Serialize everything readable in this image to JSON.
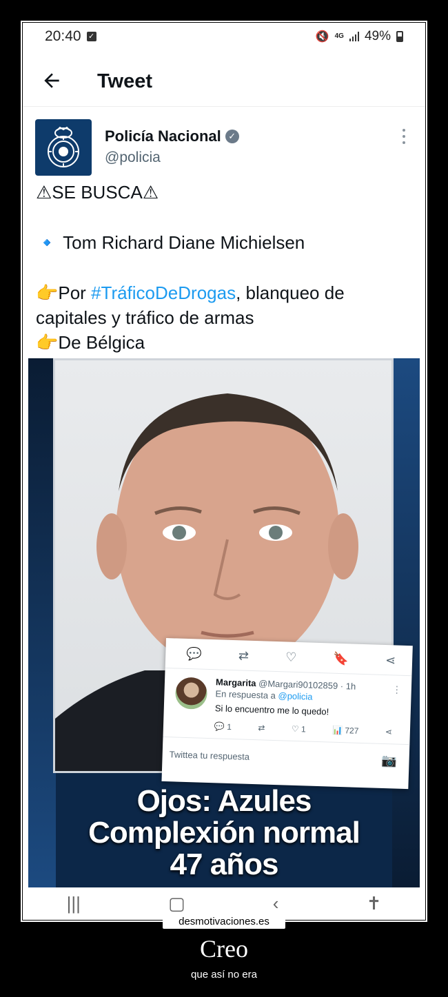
{
  "status_bar": {
    "time": "20:40",
    "battery": "49%",
    "network": "4G"
  },
  "header": {
    "title": "Tweet"
  },
  "tweet": {
    "author_name": "Policía Nacional",
    "author_handle": "@policia",
    "lines": {
      "headline": "⚠SE BUSCA⚠",
      "name_line": "🔹 Tom Richard Diane Michielsen",
      "reason_prefix": "👉Por ",
      "hashtag": "#TráficoDeDrogas",
      "reason_suffix": ", blanqueo de capitales y tráfico de armas",
      "origin": "👉De Bélgica"
    },
    "image_caption": {
      "line1": "Ojos: Azules",
      "line2": "Complexión normal",
      "line3": "47 años"
    }
  },
  "reply_card": {
    "name": "Margarita",
    "handle": "@Margari90102859 · 1h",
    "replying_prefix": "En respuesta a ",
    "replying_to": "@policia",
    "text": "Si lo encuentro me lo quedo!",
    "replies": "1",
    "likes": "1",
    "views": "727",
    "compose_placeholder": "Twittea tu respuesta"
  },
  "footer": {
    "site": "desmotivaciones.es",
    "title": "Creo",
    "subtitle": "que así no era"
  },
  "colors": {
    "link": "#1d9bf0",
    "avatar_bg": "#0e3b6b",
    "media_bg": "#0c2748"
  }
}
